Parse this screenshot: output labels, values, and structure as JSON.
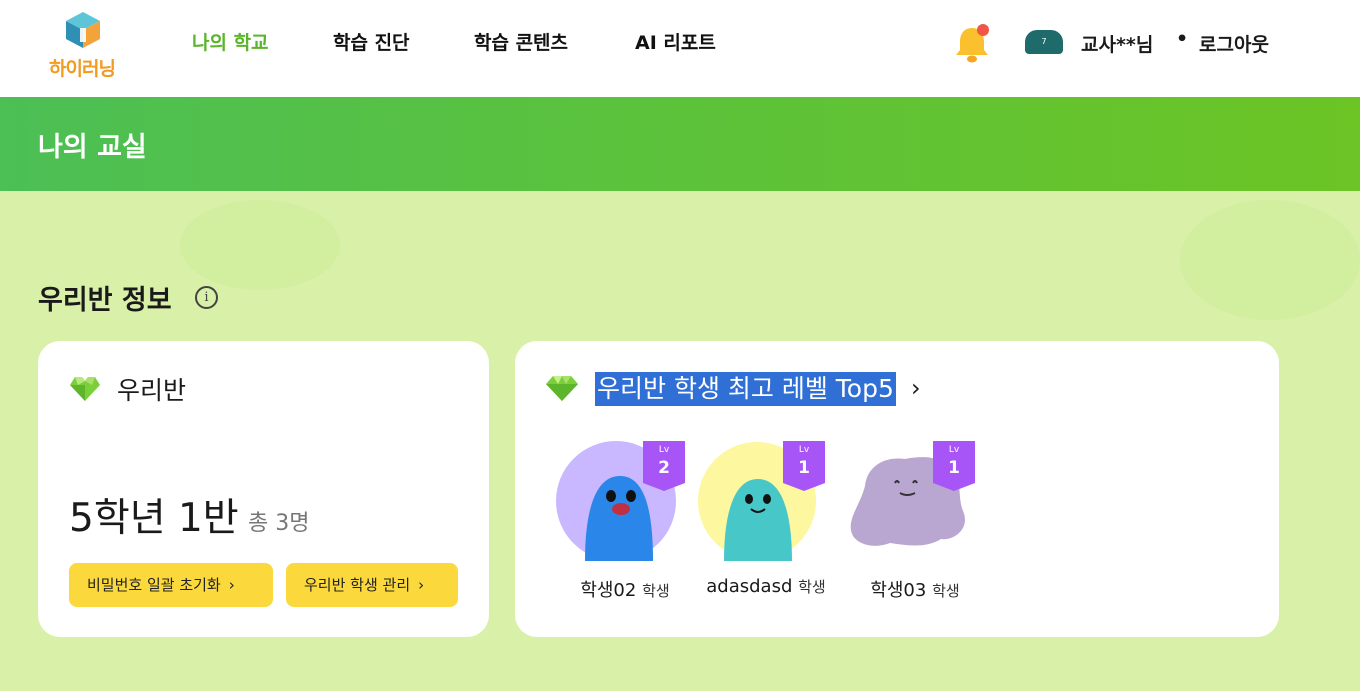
{
  "header": {
    "logo_text": "하이러닝",
    "nav": [
      {
        "label": "나의 학교",
        "active": true
      },
      {
        "label": "학습 진단",
        "active": false
      },
      {
        "label": "학습 콘텐츠",
        "active": false
      },
      {
        "label": "AI 리포트",
        "active": false
      }
    ],
    "avatar_badge": "7",
    "user_name": "교사**님",
    "separator": "•",
    "logout_label": "로그아웃",
    "accent_color": "#5ab52a"
  },
  "banner": {
    "title": "나의 교실",
    "color": "#5cc23a"
  },
  "section": {
    "title": "우리반 정보",
    "info_icon": "i"
  },
  "class_card": {
    "title": "우리반",
    "class_name": "5학년 1반",
    "count": "총 3명",
    "reset_button": "비밀번호 일괄 초기화",
    "manage_button": "우리반 학생 관리",
    "button_color": "#fbd93c"
  },
  "top_card": {
    "title": "우리반 학생 최고 레벨 Top5",
    "students": [
      {
        "name": "학생02",
        "role": "학생",
        "lv_label": "Lv",
        "level": "2",
        "avatar": "blue-blob"
      },
      {
        "name": "adasdasd",
        "role": "학생",
        "lv_label": "Lv",
        "level": "1",
        "avatar": "teal-blob"
      },
      {
        "name": "학생03",
        "role": "학생",
        "lv_label": "Lv",
        "level": "1",
        "avatar": "purple-ditto"
      }
    ]
  }
}
